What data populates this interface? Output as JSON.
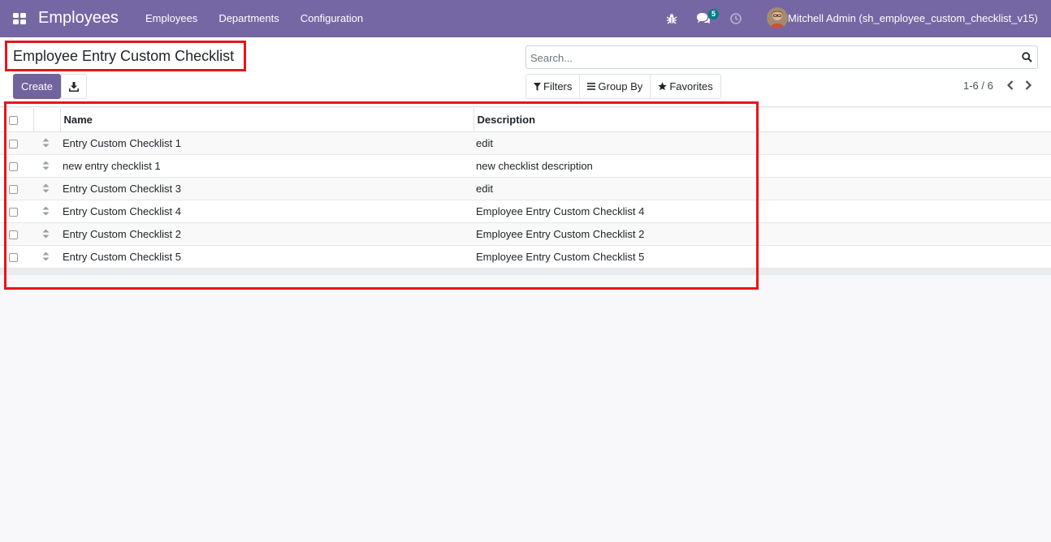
{
  "navbar": {
    "app_title": "Employees",
    "menu": [
      "Employees",
      "Departments",
      "Configuration"
    ],
    "messages_count": "5",
    "user_name": "Mitchell Admin (sh_employee_custom_checklist_v15)"
  },
  "control": {
    "page_title": "Employee Entry Custom Checklist",
    "create_label": "Create",
    "search_placeholder": "Search...",
    "filters_label": "Filters",
    "groupby_label": "Group By",
    "favorites_label": "Favorites",
    "pager": "1-6 / 6"
  },
  "list": {
    "columns": {
      "name": "Name",
      "description": "Description"
    },
    "rows": [
      {
        "name": "Entry Custom Checklist 1",
        "description": "edit"
      },
      {
        "name": "new entry checklist 1",
        "description": "new checklist description"
      },
      {
        "name": "Entry Custom Checklist 3",
        "description": "edit"
      },
      {
        "name": "Entry Custom Checklist 4",
        "description": "Employee Entry Custom Checklist 4"
      },
      {
        "name": "Entry Custom Checklist 2",
        "description": "Employee Entry Custom Checklist 2"
      },
      {
        "name": "Entry Custom Checklist 5",
        "description": "Employee Entry Custom Checklist 5"
      }
    ]
  },
  "colors": {
    "navbar": "#7567a4",
    "primary": "#71639e",
    "badge": "#017e84",
    "highlight": "#e8141a"
  }
}
